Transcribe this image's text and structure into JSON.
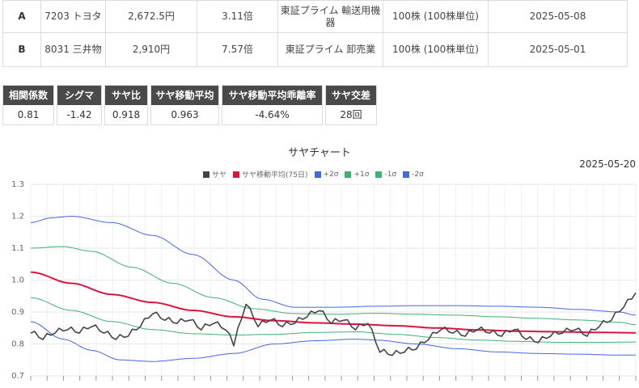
{
  "pairs": [
    {
      "label": "A",
      "code": "7203",
      "name": "トヨタ",
      "price": "2,672.5円",
      "per": "3.11倍",
      "market": "東証プライム",
      "sector": "輸送用機器",
      "unit": "100株",
      "unit_note": "(100株単位)",
      "date": "2025-05-08"
    },
    {
      "label": "B",
      "code": "8031",
      "name": "三井物",
      "price": "2,910円",
      "per": "7.57倍",
      "market": "東証プライム",
      "sector": "卸売業",
      "unit": "100株",
      "unit_note": "(100株単位)",
      "date": "2025-05-01"
    }
  ],
  "stats": [
    {
      "head": "相関係数",
      "value": "0.81"
    },
    {
      "head": "シグマ",
      "value": "-1.42"
    },
    {
      "head": "サヤ比",
      "value": "0.918"
    },
    {
      "head": "サヤ移動平均",
      "value": "0.963"
    },
    {
      "head": "サヤ移動平均乖離率",
      "value": "-4.64%"
    },
    {
      "head": "サヤ交差",
      "value": "28回"
    }
  ],
  "chart": {
    "title": "サヤチャート",
    "date": "2025-05-20",
    "legend": [
      {
        "name": "サヤ",
        "color": "#444444"
      },
      {
        "name": "サヤ移動平均(75日)",
        "color": "#dc143c"
      },
      {
        "name": "+2σ",
        "color": "#4169e1"
      },
      {
        "name": "+1σ",
        "color": "#3cb371"
      },
      {
        "name": "-1σ",
        "color": "#3cb371"
      },
      {
        "name": "-2σ",
        "color": "#4169e1"
      }
    ]
  },
  "chart_data": {
    "type": "line",
    "ylim": [
      0.7,
      1.3
    ],
    "yticks": [
      "0.7",
      "0.8",
      "0.9",
      "1.0",
      "1.1",
      "1.2",
      "1.3"
    ],
    "grid": true,
    "legend_position": "top",
    "n_points": 150,
    "series": [
      {
        "name": "サヤ",
        "color": "#444444",
        "width": 1.6,
        "anchors": [
          [
            0,
            0.84
          ],
          [
            3,
            0.82
          ],
          [
            6,
            0.84
          ],
          [
            9,
            0.85
          ],
          [
            12,
            0.84
          ],
          [
            15,
            0.86
          ],
          [
            18,
            0.84
          ],
          [
            21,
            0.82
          ],
          [
            24,
            0.83
          ],
          [
            27,
            0.86
          ],
          [
            30,
            0.9
          ],
          [
            33,
            0.88
          ],
          [
            36,
            0.87
          ],
          [
            39,
            0.88
          ],
          [
            42,
            0.85
          ],
          [
            45,
            0.87
          ],
          [
            48,
            0.85
          ],
          [
            50,
            0.8
          ],
          [
            53,
            0.93
          ],
          [
            56,
            0.86
          ],
          [
            59,
            0.88
          ],
          [
            62,
            0.86
          ],
          [
            65,
            0.87
          ],
          [
            68,
            0.89
          ],
          [
            71,
            0.91
          ],
          [
            74,
            0.87
          ],
          [
            77,
            0.88
          ],
          [
            80,
            0.85
          ],
          [
            83,
            0.87
          ],
          [
            86,
            0.78
          ],
          [
            89,
            0.77
          ],
          [
            92,
            0.78
          ],
          [
            95,
            0.79
          ],
          [
            98,
            0.82
          ],
          [
            101,
            0.85
          ],
          [
            104,
            0.84
          ],
          [
            107,
            0.83
          ],
          [
            110,
            0.85
          ],
          [
            113,
            0.84
          ],
          [
            116,
            0.83
          ],
          [
            119,
            0.85
          ],
          [
            122,
            0.82
          ],
          [
            125,
            0.81
          ],
          [
            128,
            0.83
          ],
          [
            131,
            0.84
          ],
          [
            134,
            0.85
          ],
          [
            137,
            0.83
          ],
          [
            140,
            0.86
          ],
          [
            143,
            0.88
          ],
          [
            146,
            0.92
          ],
          [
            149,
            0.96
          ]
        ]
      },
      {
        "name": "サヤ移動平均(75日)",
        "color": "#dc143c",
        "width": 2,
        "anchors": [
          [
            0,
            1.025
          ],
          [
            10,
            0.99
          ],
          [
            20,
            0.955
          ],
          [
            30,
            0.93
          ],
          [
            40,
            0.905
          ],
          [
            50,
            0.885
          ],
          [
            60,
            0.873
          ],
          [
            70,
            0.866
          ],
          [
            80,
            0.862
          ],
          [
            90,
            0.857
          ],
          [
            100,
            0.85
          ],
          [
            110,
            0.844
          ],
          [
            120,
            0.84
          ],
          [
            130,
            0.838
          ],
          [
            140,
            0.836
          ],
          [
            149,
            0.835
          ]
        ]
      },
      {
        "name": "+2σ",
        "color": "#4169e1",
        "width": 1,
        "anchors": [
          [
            0,
            1.18
          ],
          [
            5,
            1.195
          ],
          [
            10,
            1.2
          ],
          [
            20,
            1.18
          ],
          [
            30,
            1.14
          ],
          [
            40,
            1.08
          ],
          [
            50,
            1.0
          ],
          [
            57,
            0.94
          ],
          [
            65,
            0.915
          ],
          [
            75,
            0.915
          ],
          [
            85,
            0.918
          ],
          [
            95,
            0.92
          ],
          [
            105,
            0.92
          ],
          [
            115,
            0.918
          ],
          [
            125,
            0.915
          ],
          [
            135,
            0.908
          ],
          [
            145,
            0.9
          ],
          [
            149,
            0.89
          ]
        ]
      },
      {
        "name": "+1σ",
        "color": "#3cb371",
        "width": 1,
        "anchors": [
          [
            0,
            1.1
          ],
          [
            8,
            1.105
          ],
          [
            15,
            1.09
          ],
          [
            25,
            1.04
          ],
          [
            35,
            0.99
          ],
          [
            45,
            0.945
          ],
          [
            55,
            0.91
          ],
          [
            65,
            0.895
          ],
          [
            75,
            0.893
          ],
          [
            85,
            0.896
          ],
          [
            95,
            0.893
          ],
          [
            105,
            0.89
          ],
          [
            115,
            0.885
          ],
          [
            125,
            0.88
          ],
          [
            135,
            0.875
          ],
          [
            145,
            0.868
          ],
          [
            149,
            0.86
          ]
        ]
      },
      {
        "name": "-1σ",
        "color": "#3cb371",
        "width": 1,
        "anchors": [
          [
            0,
            0.945
          ],
          [
            10,
            0.905
          ],
          [
            20,
            0.87
          ],
          [
            30,
            0.845
          ],
          [
            40,
            0.832
          ],
          [
            50,
            0.828
          ],
          [
            60,
            0.83
          ],
          [
            70,
            0.836
          ],
          [
            80,
            0.838
          ],
          [
            90,
            0.83
          ],
          [
            100,
            0.82
          ],
          [
            110,
            0.812
          ],
          [
            120,
            0.808
          ],
          [
            130,
            0.805
          ],
          [
            140,
            0.805
          ],
          [
            149,
            0.806
          ]
        ]
      },
      {
        "name": "-2σ",
        "color": "#4169e1",
        "width": 1,
        "anchors": [
          [
            0,
            0.87
          ],
          [
            8,
            0.815
          ],
          [
            15,
            0.78
          ],
          [
            22,
            0.75
          ],
          [
            30,
            0.745
          ],
          [
            40,
            0.755
          ],
          [
            50,
            0.77
          ],
          [
            60,
            0.8
          ],
          [
            70,
            0.81
          ],
          [
            80,
            0.815
          ],
          [
            85,
            0.812
          ],
          [
            95,
            0.8
          ],
          [
            105,
            0.785
          ],
          [
            115,
            0.775
          ],
          [
            125,
            0.77
          ],
          [
            135,
            0.768
          ],
          [
            145,
            0.765
          ],
          [
            149,
            0.765
          ]
        ]
      }
    ]
  }
}
